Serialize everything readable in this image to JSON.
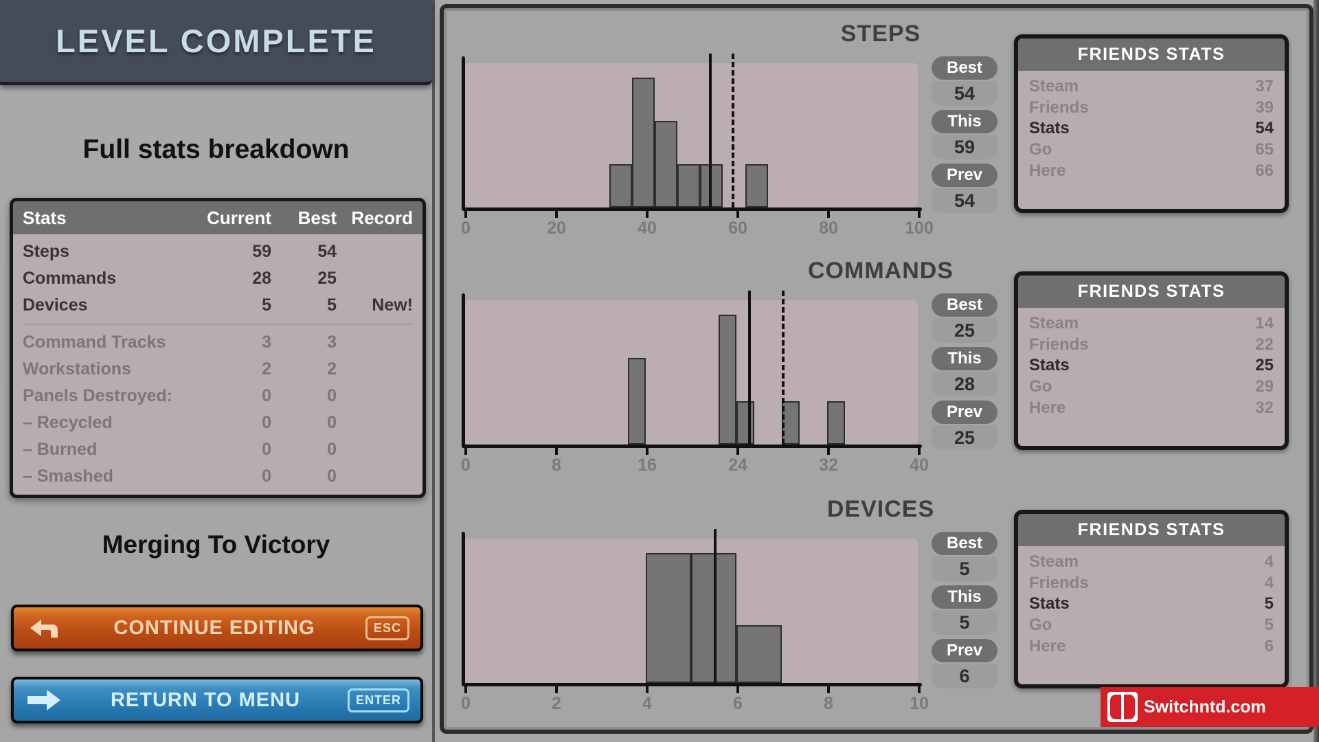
{
  "header": {
    "title": "LEVEL COMPLETE"
  },
  "left": {
    "subtitle": "Full stats breakdown",
    "level_name": "Merging To Victory",
    "table": {
      "columns": [
        "Stats",
        "Current",
        "Best",
        "Record"
      ],
      "primary_rows": [
        {
          "name": "Steps",
          "current": "59",
          "best": "54",
          "record": ""
        },
        {
          "name": "Commands",
          "current": "28",
          "best": "25",
          "record": ""
        },
        {
          "name": "Devices",
          "current": "5",
          "best": "5",
          "record": "New!"
        }
      ],
      "secondary_rows": [
        {
          "name": "Command Tracks",
          "current": "3",
          "best": "3",
          "record": ""
        },
        {
          "name": "Workstations",
          "current": "2",
          "best": "2",
          "record": ""
        },
        {
          "name": "Panels Destroyed:",
          "current": "0",
          "best": "0",
          "record": ""
        },
        {
          "name": "– Recycled",
          "current": "0",
          "best": "0",
          "record": ""
        },
        {
          "name": "– Burned",
          "current": "0",
          "best": "0",
          "record": ""
        },
        {
          "name": "– Smashed",
          "current": "0",
          "best": "0",
          "record": ""
        }
      ]
    },
    "buttons": [
      {
        "label": "CONTINUE EDITING",
        "key": "ESC",
        "icon": "arrow-back-icon"
      },
      {
        "label": "RETURN TO MENU",
        "key": "ENTER",
        "icon": "arrow-forward-icon"
      }
    ]
  },
  "charts": [
    {
      "id": "steps",
      "title": "STEPS",
      "side": {
        "best_label": "Best",
        "best": "54",
        "this_label": "This",
        "this": "59",
        "prev_label": "Prev",
        "prev": "54"
      },
      "friends": {
        "title": "FRIENDS STATS",
        "rows": [
          {
            "name": "Steam",
            "value": "37",
            "highlight": false
          },
          {
            "name": "Friends",
            "value": "39",
            "highlight": false
          },
          {
            "name": "Stats",
            "value": "54",
            "highlight": true
          },
          {
            "name": "Go",
            "value": "65",
            "highlight": false
          },
          {
            "name": "Here",
            "value": "66",
            "highlight": false
          }
        ]
      }
    },
    {
      "id": "commands",
      "title": "COMMANDS",
      "side": {
        "best_label": "Best",
        "best": "25",
        "this_label": "This",
        "this": "28",
        "prev_label": "Prev",
        "prev": "25"
      },
      "friends": {
        "title": "FRIENDS STATS",
        "rows": [
          {
            "name": "Steam",
            "value": "14",
            "highlight": false
          },
          {
            "name": "Friends",
            "value": "22",
            "highlight": false
          },
          {
            "name": "Stats",
            "value": "25",
            "highlight": true
          },
          {
            "name": "Go",
            "value": "29",
            "highlight": false
          },
          {
            "name": "Here",
            "value": "32",
            "highlight": false
          }
        ]
      }
    },
    {
      "id": "devices",
      "title": "DEVICES",
      "side": {
        "best_label": "Best",
        "best": "5",
        "this_label": "This",
        "this": "5",
        "prev_label": "Prev",
        "prev": "6"
      },
      "friends": {
        "title": "FRIENDS STATS",
        "rows": [
          {
            "name": "Steam",
            "value": "4",
            "highlight": false
          },
          {
            "name": "Friends",
            "value": "4",
            "highlight": false
          },
          {
            "name": "Stats",
            "value": "5",
            "highlight": true
          },
          {
            "name": "Go",
            "value": "5",
            "highlight": false
          },
          {
            "name": "Here",
            "value": "6",
            "highlight": false
          }
        ]
      }
    }
  ],
  "chart_data": [
    {
      "type": "bar",
      "title": "STEPS",
      "xlabel": "",
      "ylabel": "",
      "xlim": [
        0,
        100
      ],
      "ylim": [
        0,
        10
      ],
      "grid": false,
      "legend": "none",
      "tick_labels": [
        "0",
        "20",
        "40",
        "60",
        "80",
        "100"
      ],
      "ticks": [
        0,
        20,
        40,
        60,
        80,
        100
      ],
      "bin_width": 5,
      "bins": [
        32,
        37,
        42,
        47,
        52,
        62
      ],
      "values": [
        3,
        9,
        6,
        3,
        3,
        3
      ],
      "markers": [
        {
          "name": "best",
          "x": 54,
          "style": "solid",
          "label": "54"
        },
        {
          "name": "this",
          "x": 59,
          "style": "dashed",
          "label": "59"
        }
      ]
    },
    {
      "type": "bar",
      "title": "COMMANDS",
      "xlabel": "",
      "ylabel": "",
      "xlim": [
        0,
        40
      ],
      "ylim": [
        0,
        10
      ],
      "grid": false,
      "legend": "none",
      "tick_labels": [
        "0",
        "8",
        "16",
        "24",
        "32",
        "40"
      ],
      "ticks": [
        0,
        8,
        16,
        24,
        32,
        40
      ],
      "bin_width": 1.6,
      "bins": [
        14.4,
        22.4,
        24,
        28,
        32
      ],
      "values": [
        6,
        9,
        3,
        3,
        3
      ],
      "markers": [
        {
          "name": "best",
          "x": 25,
          "style": "solid",
          "label": "25"
        },
        {
          "name": "this",
          "x": 28,
          "style": "dashed",
          "label": "28"
        }
      ]
    },
    {
      "type": "bar",
      "title": "DEVICES",
      "xlabel": "",
      "ylabel": "",
      "xlim": [
        0,
        10
      ],
      "ylim": [
        0,
        10
      ],
      "grid": false,
      "legend": "none",
      "tick_labels": [
        "0",
        "2",
        "4",
        "6",
        "8",
        "10"
      ],
      "ticks": [
        0,
        2,
        4,
        6,
        8,
        10
      ],
      "bin_width": 1,
      "bins": [
        4,
        5,
        6
      ],
      "values": [
        9,
        9,
        4
      ],
      "markers": [
        {
          "name": "best",
          "x": 5.5,
          "style": "solid",
          "label": "5"
        }
      ]
    }
  ],
  "watermark": {
    "text": "Switchntd.com",
    "brand_color": "#d42027"
  }
}
